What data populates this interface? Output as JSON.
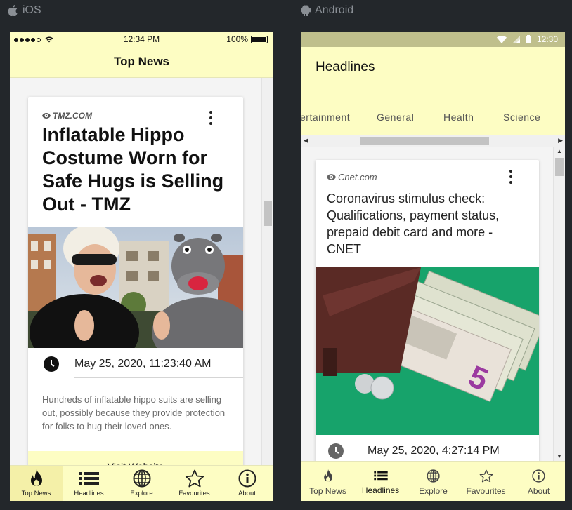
{
  "platforms": {
    "ios_label": "iOS",
    "android_label": "Android"
  },
  "ios": {
    "status": {
      "time": "12:34 PM",
      "battery": "100%"
    },
    "nav_title": "Top News",
    "article": {
      "source": "TMZ.COM",
      "headline": "Inflatable Hippo Costume Worn for Safe Hugs is Selling Out - TMZ",
      "date": "May 25, 2020, 11:23:40 AM",
      "description": "Hundreds of inflatable hippo suits are selling out, possibly because they provide protection for folks to hug their loved ones.",
      "button": "Visit Website"
    },
    "tabs": [
      {
        "label": "Top News",
        "icon": "flame-icon",
        "active": true
      },
      {
        "label": "Headlines",
        "icon": "list-icon",
        "active": false
      },
      {
        "label": "Explore",
        "icon": "globe-icon",
        "active": false
      },
      {
        "label": "Favourites",
        "icon": "star-icon",
        "active": false
      },
      {
        "label": "About",
        "icon": "info-icon",
        "active": false
      }
    ]
  },
  "android": {
    "status": {
      "time": "12:30"
    },
    "app_title": "Headlines",
    "category_tabs": [
      "ertainment",
      "General",
      "Health",
      "Science"
    ],
    "article": {
      "source": "Cnet.com",
      "headline": "Coronavirus stimulus check: Qualifications, payment status, prepaid debit card and more - CNET",
      "date": "May 25, 2020, 4:27:14 PM"
    },
    "tabs": [
      {
        "label": "Top News",
        "icon": "flame-icon",
        "active": false
      },
      {
        "label": "Headlines",
        "icon": "list-icon",
        "active": true
      },
      {
        "label": "Explore",
        "icon": "globe-icon",
        "active": false
      },
      {
        "label": "Favourites",
        "icon": "star-icon",
        "active": false
      },
      {
        "label": "About",
        "icon": "info-icon",
        "active": false
      }
    ]
  },
  "colors": {
    "accent_yellow": "#fdfdc3",
    "android_status": "#bfbf8c",
    "background": "#23272b"
  }
}
